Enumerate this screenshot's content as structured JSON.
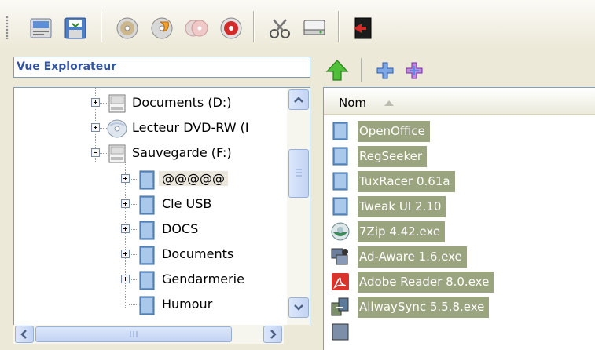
{
  "toolbar": {
    "buttons": [
      {
        "icon": "properties-icon"
      },
      {
        "icon": "save-icon"
      },
      {
        "icon": "disc-icon"
      },
      {
        "icon": "burn-disc-icon"
      },
      {
        "icon": "disc-copy-icon"
      },
      {
        "icon": "disc-erase-icon"
      },
      {
        "icon": "scissors-icon"
      },
      {
        "icon": "drive-icon"
      },
      {
        "icon": "exit-icon"
      }
    ]
  },
  "explorer": {
    "view_label": "Vue Explorateur",
    "tree": [
      {
        "label": "Documents (D:)",
        "state": "collapsed",
        "icon": "drive-icon"
      },
      {
        "label": "Lecteur DVD-RW (I",
        "state": "collapsed",
        "icon": "dvd-drive-icon"
      },
      {
        "label": "Sauvegarde (F:)",
        "state": "expanded",
        "icon": "drive-icon"
      },
      {
        "label": "@@@@@",
        "state": "collapsed",
        "icon": "folder-icon",
        "selected": true
      },
      {
        "label": "Cle USB",
        "state": "collapsed",
        "icon": "folder-icon"
      },
      {
        "label": "DOCS",
        "state": "collapsed",
        "icon": "folder-icon"
      },
      {
        "label": "Documents",
        "state": "collapsed",
        "icon": "folder-icon"
      },
      {
        "label": "Gendarmerie",
        "state": "collapsed",
        "icon": "folder-icon"
      },
      {
        "label": "Humour",
        "state": "none",
        "icon": "folder-icon"
      }
    ]
  },
  "file_list": {
    "column_header": "Nom",
    "sort": "ascending",
    "items": [
      {
        "label": "OpenOffice",
        "icon": "folder-icon"
      },
      {
        "label": "RegSeeker",
        "icon": "folder-icon"
      },
      {
        "label": "TuxRacer 0.61a",
        "icon": "folder-icon"
      },
      {
        "label": "Tweak UI 2.10",
        "icon": "folder-icon"
      },
      {
        "label": "7Zip 4.42.exe",
        "icon": "7zip-icon"
      },
      {
        "label": "Ad-Aware 1.6.exe",
        "icon": "adaware-icon"
      },
      {
        "label": "Adobe Reader 8.0.exe",
        "icon": "adobe-reader-icon"
      },
      {
        "label": "AllwaySync 5.5.8.exe",
        "icon": "allwaysync-icon"
      }
    ]
  },
  "colors": {
    "selection": "#9aa57f",
    "combo_text": "#3254a5",
    "folder": "#6c98c8"
  }
}
